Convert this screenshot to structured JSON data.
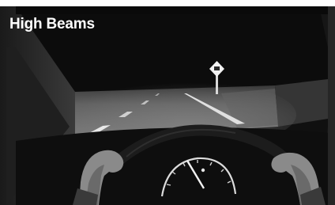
{
  "caption": {
    "label": "High Beams"
  },
  "scene": {
    "description_icon": "night-driving-high-beam-scene",
    "colors": {
      "sky": "#0b0b0b",
      "cabin": "#121212",
      "road": "#6d6d6d",
      "lane_marking": "#e8e8e8",
      "hands": "#8a8a8a",
      "wheel": "#1c1c1c"
    }
  }
}
